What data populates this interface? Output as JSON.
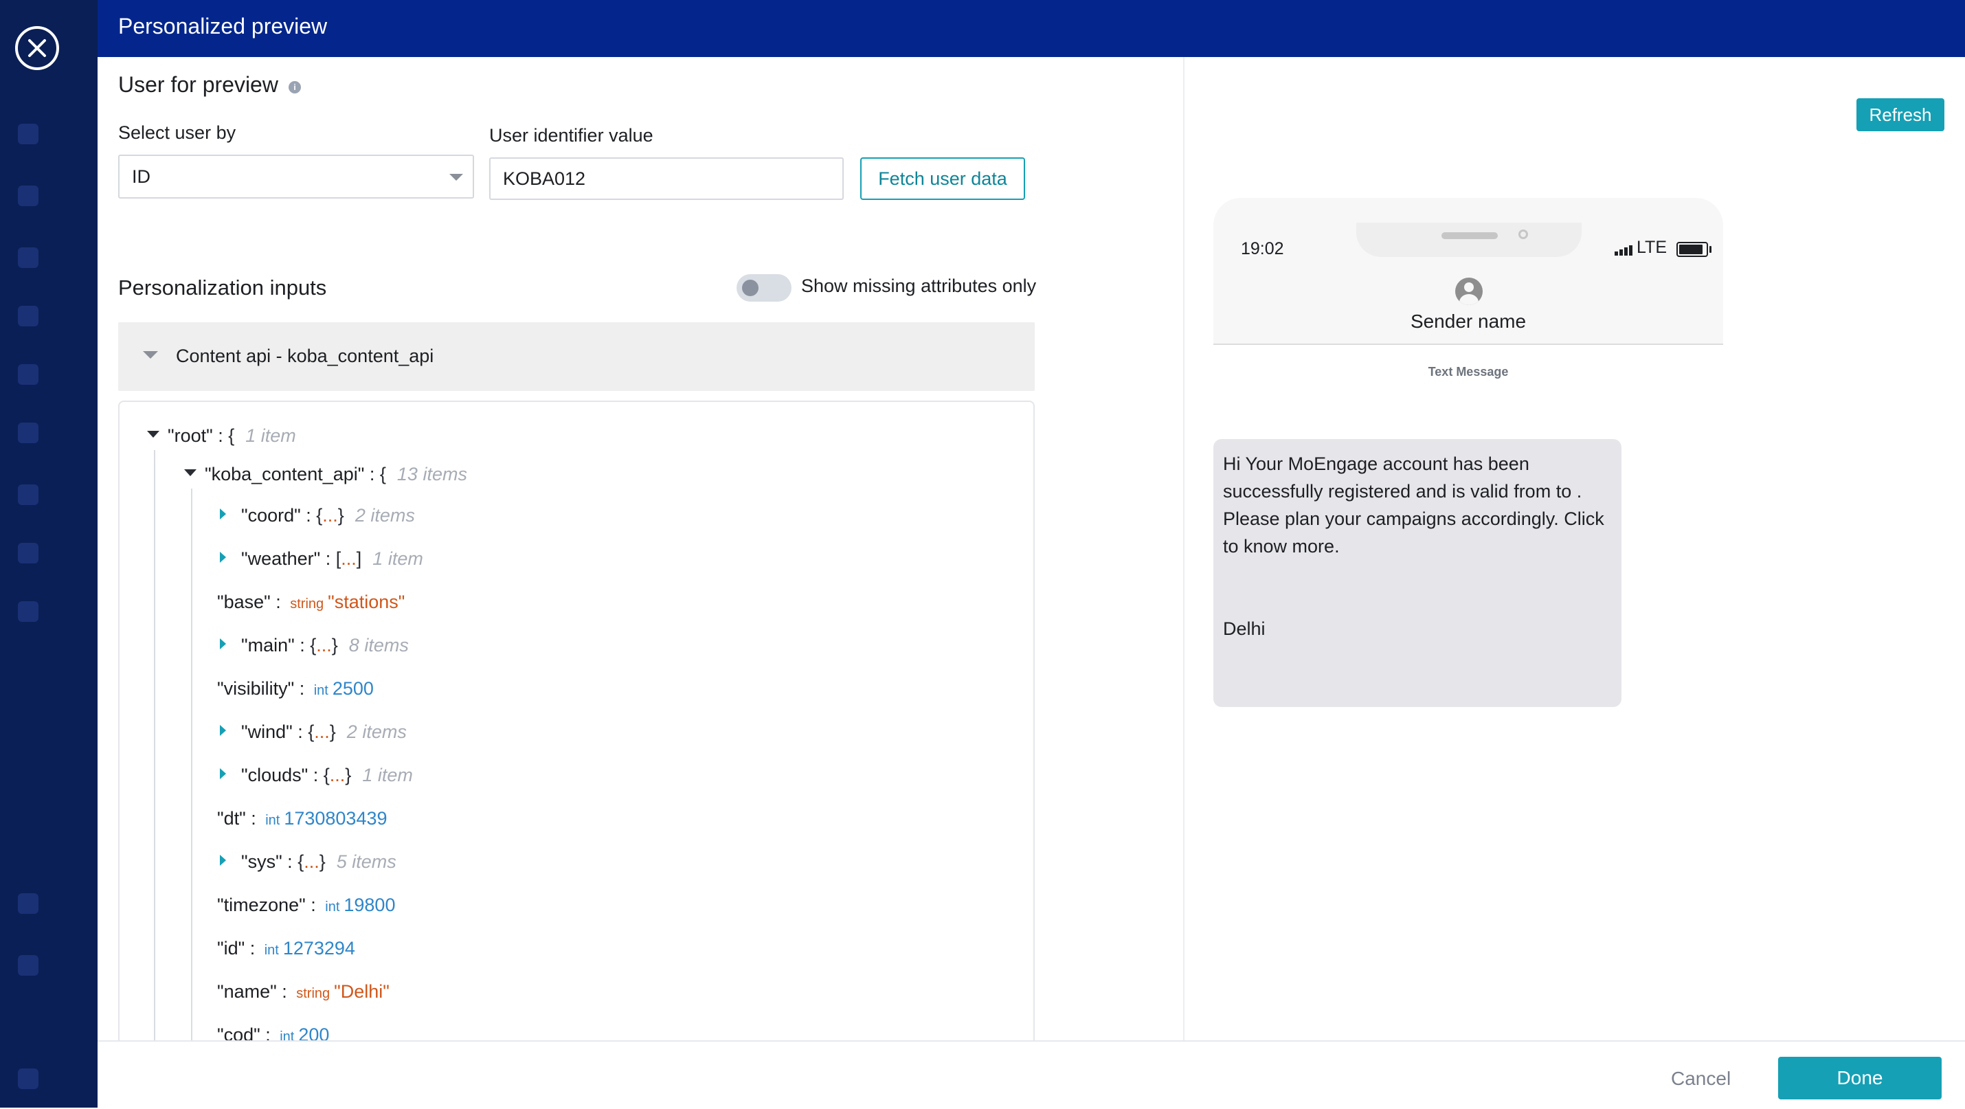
{
  "modal": {
    "title": "Personalized preview"
  },
  "user_preview": {
    "title": "User for preview",
    "info_icon": "info-icon",
    "select_label": "Select user by",
    "select_value": "ID",
    "identifier_label": "User identifier value",
    "identifier_value": "KOBA012",
    "fetch_button": "Fetch user data"
  },
  "personalization": {
    "title": "Personalization inputs",
    "toggle_label": "Show missing attributes only",
    "toggle_on": false,
    "accordion_label": "Content api - koba_content_api"
  },
  "json_tree": {
    "root": {
      "key": "\"root\"",
      "sep": " : ",
      "brace": "{",
      "count": "1 item"
    },
    "api": {
      "key": "\"koba_content_api\"",
      "sep": " : ",
      "brace": "{",
      "count": "13 items"
    },
    "nodes": [
      {
        "key": "\"coord\"",
        "sep": " : ",
        "open": "{",
        "dots": "...",
        "close": "}",
        "count": "2 items"
      },
      {
        "key": "\"weather\"",
        "sep": " : ",
        "open": "[",
        "dots": "...",
        "close": "]",
        "count": "1 item"
      },
      {
        "key": "\"base\"",
        "sep": " : ",
        "type": "string",
        "value": "\"stations\""
      },
      {
        "key": "\"main\"",
        "sep": " : ",
        "open": "{",
        "dots": "...",
        "close": "}",
        "count": "8 items"
      },
      {
        "key": "\"visibility\"",
        "sep": " : ",
        "type": "int",
        "value": "2500"
      },
      {
        "key": "\"wind\"",
        "sep": " : ",
        "open": "{",
        "dots": "...",
        "close": "}",
        "count": "2 items"
      },
      {
        "key": "\"clouds\"",
        "sep": " : ",
        "open": "{",
        "dots": "...",
        "close": "}",
        "count": "1 item"
      },
      {
        "key": "\"dt\"",
        "sep": " : ",
        "type": "int",
        "value": "1730803439"
      },
      {
        "key": "\"sys\"",
        "sep": " : ",
        "open": "{",
        "dots": "...",
        "close": "}",
        "count": "5 items"
      },
      {
        "key": "\"timezone\"",
        "sep": " : ",
        "type": "int",
        "value": "19800"
      },
      {
        "key": "\"id\"",
        "sep": " : ",
        "type": "int",
        "value": "1273294"
      },
      {
        "key": "\"name\"",
        "sep": " : ",
        "type": "string",
        "value": "\"Delhi\""
      },
      {
        "key": "\"cod\"",
        "sep": " : ",
        "type": "int",
        "value": "200"
      }
    ]
  },
  "preview": {
    "refresh_button": "Refresh",
    "phone_time": "19:02",
    "network": "LTE",
    "sender_name": "Sender name",
    "message_type": "Text Message",
    "message": "Hi Your MoEngage account has been successfully registered and is valid from to . Please plan your campaigns accordingly. Click to know more.\n\n\nDelhi"
  },
  "footer": {
    "cancel": "Cancel",
    "done": "Done"
  },
  "colors": {
    "header": "#04268c",
    "accent": "#15a0b5",
    "string_value": "#d0571a",
    "int_value": "#2f86c9"
  }
}
